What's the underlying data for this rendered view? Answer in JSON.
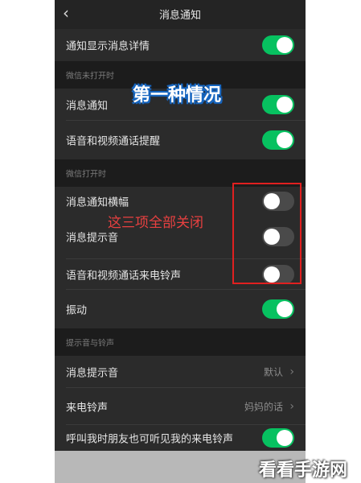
{
  "header": {
    "title": "消息通知",
    "back_glyph": "‹"
  },
  "rows": {
    "show_detail": {
      "label": "通知显示消息详情",
      "on": true
    },
    "notice": {
      "label": "消息通知",
      "on": true
    },
    "av_remind": {
      "label": "语音和视频通话提醒",
      "on": true
    },
    "banner": {
      "label": "消息通知横幅",
      "on": false
    },
    "tone": {
      "label": "消息提示音",
      "on": false
    },
    "av_ring": {
      "label": "语音和视频通话来电铃声",
      "on": false
    },
    "vibrate": {
      "label": "振动",
      "on": true
    },
    "msg_tone": {
      "label": "消息提示音",
      "value": "默认"
    },
    "ringtone": {
      "label": "来电铃声",
      "value": "妈妈的话"
    },
    "friend_hear": {
      "label": "呼叫我时朋友也可听见我的来电铃声",
      "on": true
    }
  },
  "sections": {
    "closed": "微信未打开时",
    "open": "微信打开时",
    "tones": "提示音与铃声"
  },
  "overlays": {
    "case_label": "第一种情况",
    "annotation": "这三项全部关闭",
    "watermark": "看看手游网"
  },
  "colors": {
    "toggle_on": "#07c160",
    "toggle_off": "#4a4a4a",
    "annotation_red": "#e02020"
  },
  "icons": {
    "back": "chevron-left-icon",
    "row_arrow": "chevron-right-icon"
  }
}
